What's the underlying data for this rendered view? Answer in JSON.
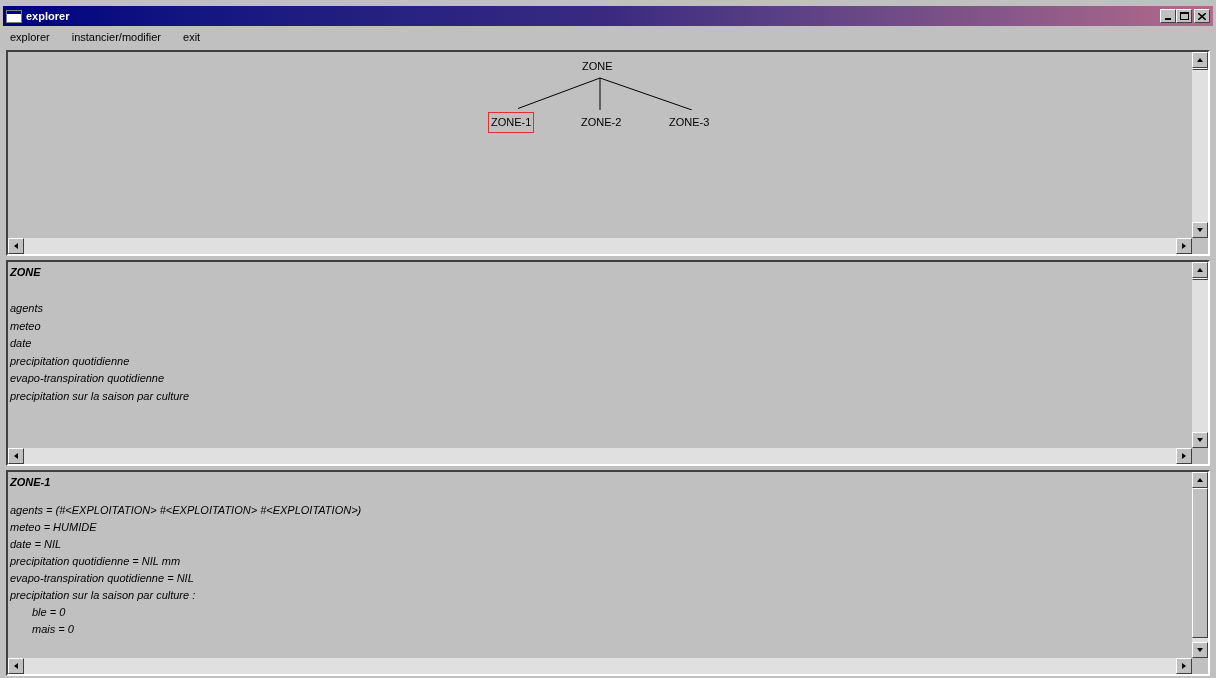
{
  "window": {
    "title": "explorer"
  },
  "menu": [
    "explorer",
    "instancier/modifier",
    "exit"
  ],
  "tree": {
    "root": "ZONE",
    "children": [
      {
        "label": "ZONE-1",
        "selected": true
      },
      {
        "label": "ZONE-2",
        "selected": false
      },
      {
        "label": "ZONE-3",
        "selected": false
      }
    ]
  },
  "class_panel": {
    "title": "ZONE",
    "lines": [
      "agents",
      "meteo",
      "date",
      "precipitation quotidienne",
      "evapo-transpiration quotidienne",
      "precipitation sur la saison par culture"
    ]
  },
  "instance_panel": {
    "title": "ZONE-1",
    "lines": [
      {
        "text": "agents = (#<EXPLOITATION> #<EXPLOITATION> #<EXPLOITATION>)",
        "indented": false
      },
      {
        "text": "meteo = HUMIDE",
        "indented": false
      },
      {
        "text": "date = NIL",
        "indented": false
      },
      {
        "text": "precipitation quotidienne = NIL mm",
        "indented": false
      },
      {
        "text": "evapo-transpiration quotidienne = NIL",
        "indented": false
      },
      {
        "text": "precipitation sur la saison par culture :",
        "indented": false
      },
      {
        "text": "ble = 0",
        "indented": true
      },
      {
        "text": "mais = 0",
        "indented": true
      }
    ]
  }
}
